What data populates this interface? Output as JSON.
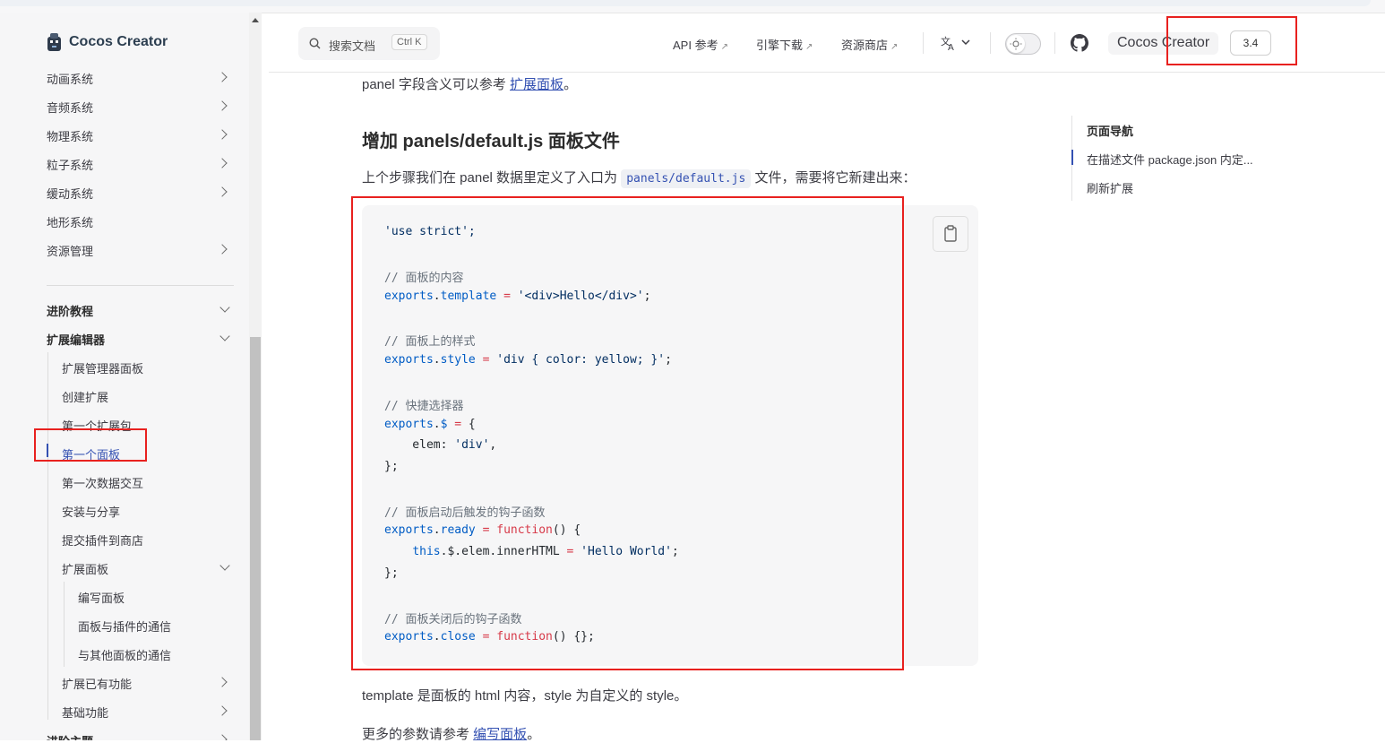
{
  "sidebar": {
    "logo_text": "Cocos Creator",
    "items_top": [
      "动画系统",
      "音频系统",
      "物理系统",
      "粒子系统",
      "缓动系统",
      "地形系统",
      "资源管理"
    ],
    "section_advanced": "进阶教程",
    "section_extension": "扩展编辑器",
    "ext_items": [
      "扩展管理器面板",
      "创建扩展",
      "第一个扩展包",
      "第一个面板",
      "第一次数据交互",
      "安装与分享",
      "提交插件到商店",
      "扩展面板"
    ],
    "panel_children": [
      "编写面板",
      "面板与插件的通信",
      "与其他面板的通信"
    ],
    "ext_items_after": [
      "扩展已有功能",
      "基础功能"
    ],
    "cut_off_item": "进阶主题"
  },
  "nav": {
    "search_placeholder": "搜索文档",
    "search_shortcut": "Ctrl K",
    "api_link": "API 参考",
    "engine_link": "引擎下载",
    "store_link": "资源商店",
    "external_arrow": "↗",
    "brand": "Cocos Creator",
    "version": "3.4"
  },
  "content": {
    "intro_prefix": "panel 字段含义可以参考 ",
    "intro_link": "扩展面板",
    "intro_suffix": "。",
    "heading": "增加 panels/default.js 面板文件",
    "desc_prefix": "上个步骤我们在 panel 数据里定义了入口为 ",
    "desc_code": "panels/default.js",
    "desc_suffix": " 文件，需要将它新建出来：",
    "code": {
      "l1": "'use strict';",
      "c1": "// 面板的内容",
      "l2_obj": "exports",
      "l2_prop": "template",
      "l2_val": "'<div>Hello</div>'",
      "c2": "// 面板上的样式",
      "l3_prop": "style",
      "l3_val": "'div { color: yellow; }'",
      "c3": "// 快捷选择器",
      "l4_prop": "$",
      "l5": "    elem: ",
      "l5_val": "'div'",
      "c4": "// 面板启动后触发的钩子函数",
      "l7_prop": "ready",
      "fn_kw": "function",
      "l8_this": "this",
      "l8_rest": ".$.elem.innerHTML ",
      "l8_val": "'Hello World'",
      "c5": "// 面板关闭后的钩子函数",
      "l10_prop": "close"
    },
    "after_code": "template 是面板的 html 内容，style 为自定义的 style。",
    "more_prefix": "更多的参数请参考 ",
    "more_link": "编写面板",
    "more_suffix": "。"
  },
  "aside": {
    "title": "页面导航",
    "items": [
      "在描述文件 package.json 内定...",
      "刷新扩展"
    ]
  },
  "colors": {
    "accent": "#3451b2",
    "annotation_red": "#e8211f"
  }
}
